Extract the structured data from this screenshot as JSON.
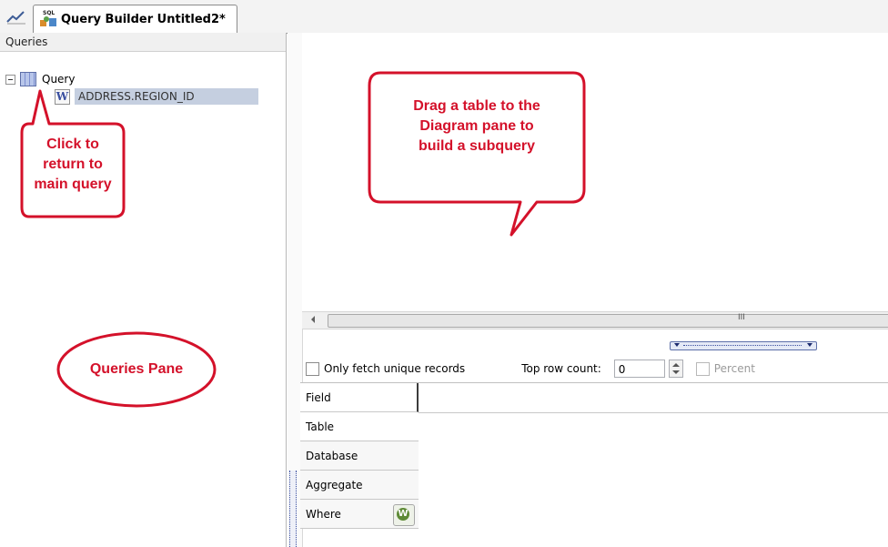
{
  "tab": {
    "title": "Query Builder Untitled2*"
  },
  "queries_pane": {
    "header": "Queries",
    "root": "Query",
    "child": "ADDRESS.REGION_ID",
    "child_icon_letter": "W"
  },
  "options": {
    "unique_label": "Only fetch unique records",
    "top_row_label": "Top row count:",
    "top_row_value": "0",
    "percent_label": "Percent"
  },
  "grid": {
    "rows": [
      "Field",
      "Table",
      "Database",
      "Aggregate",
      "Where"
    ]
  },
  "callouts": {
    "diagram_line1": "Drag a table to the",
    "diagram_line2": "Diagram pane to",
    "diagram_line3": "build a subquery",
    "click_line1": "Click to",
    "click_line2": "return to",
    "click_line3": "main query",
    "queries_pane": "Queries Pane"
  },
  "colors": {
    "callout_red": "#d4112a",
    "selection": "#c5cfe0"
  },
  "hscroll_grip": "III"
}
